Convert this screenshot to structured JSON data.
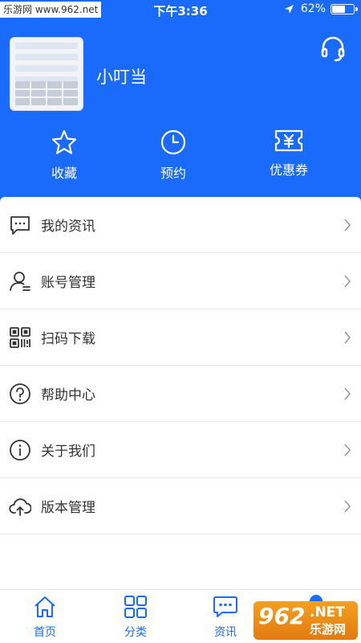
{
  "status_bar": {
    "watermark": "乐游网 www.962.net",
    "time": "下午3:36",
    "battery_text": "62%",
    "battery_level": 0.62
  },
  "profile": {
    "username": "小叮当"
  },
  "quick_actions": [
    {
      "label": "收藏",
      "icon": "star-icon"
    },
    {
      "label": "预约",
      "icon": "clock-icon"
    },
    {
      "label": "优惠券",
      "icon": "ticket-icon"
    }
  ],
  "menu": [
    {
      "label": "我的资讯",
      "icon": "message-icon"
    },
    {
      "label": "账号管理",
      "icon": "user-icon"
    },
    {
      "label": "扫码下载",
      "icon": "qrcode-icon"
    },
    {
      "label": "帮助中心",
      "icon": "help-icon"
    },
    {
      "label": "关于我们",
      "icon": "info-icon"
    },
    {
      "label": "版本管理",
      "icon": "cloud-upload-icon"
    }
  ],
  "tabbar": [
    {
      "label": "首页",
      "icon": "home-icon"
    },
    {
      "label": "分类",
      "icon": "grid-icon"
    },
    {
      "label": "资讯",
      "icon": "chat-icon"
    }
  ],
  "watermark_bottom": {
    "number": "962",
    "suffix": ".NET",
    "name": "乐游网"
  },
  "colors": {
    "accent": "#1a6bfb",
    "text": "#333333",
    "divider": "#e8e8e8"
  }
}
